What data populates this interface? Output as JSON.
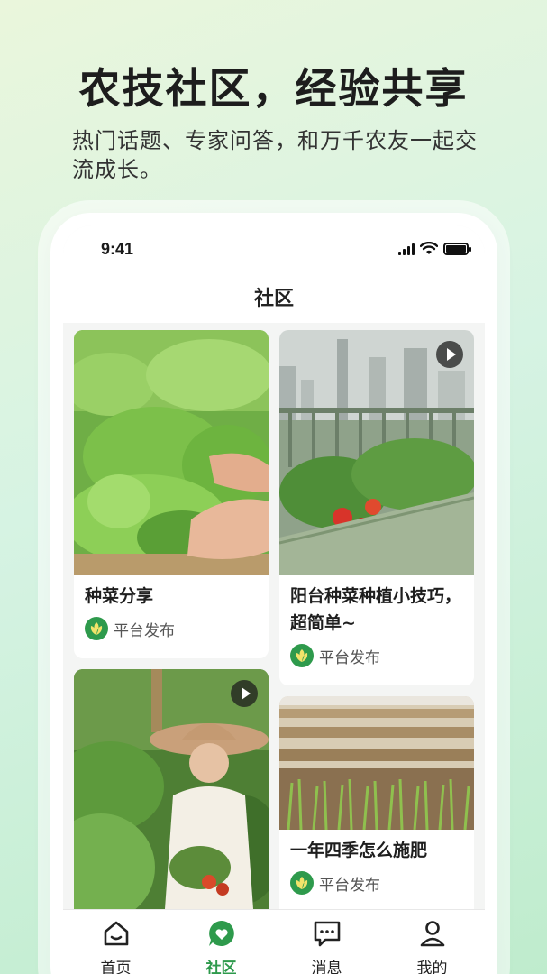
{
  "promo": {
    "headline": "农技社区，经验共享",
    "subline": "热门话题、专家问答，和万千农友一起交流成长。"
  },
  "status_bar": {
    "time": "9:41",
    "icons": [
      "signal-icon",
      "wifi-icon",
      "battery-icon"
    ]
  },
  "nav": {
    "title": "社区"
  },
  "feed": {
    "left": [
      {
        "title": "种菜分享",
        "source": "平台发布",
        "video": false,
        "image": "lettuce-harvest"
      },
      {
        "title": "",
        "source": "",
        "video": true,
        "image": "woman-in-garden"
      }
    ],
    "right": [
      {
        "title": "阳台种菜种植小技巧，超简单~",
        "source": "平台发布",
        "video": true,
        "image": "balcony-planter"
      },
      {
        "title": "一年四季怎么施肥",
        "source": "平台发布",
        "video": false,
        "image": "raised-beds"
      }
    ]
  },
  "tabbar": {
    "items": [
      {
        "label": "首页",
        "icon": "home-icon",
        "active": false
      },
      {
        "label": "社区",
        "icon": "community-heart-icon",
        "active": true
      },
      {
        "label": "消息",
        "icon": "message-icon",
        "active": false
      },
      {
        "label": "我的",
        "icon": "profile-icon",
        "active": false
      }
    ]
  },
  "colors": {
    "accent": "#2e9a4c",
    "background_gradient": [
      "#eaf6dc",
      "#bfeccd"
    ]
  }
}
